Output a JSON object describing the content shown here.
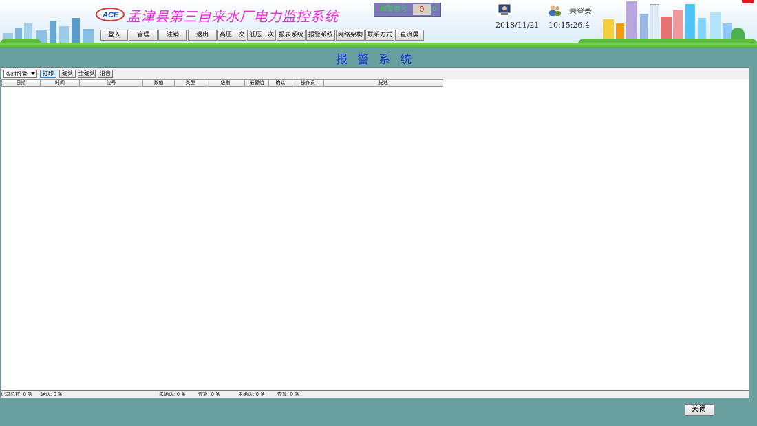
{
  "header": {
    "title": "孟津县第三自来水厂电力监控系统",
    "logo_text": "ACE",
    "status_label": "報警信号",
    "status_count": "0",
    "status_btn": "0",
    "login_status": "未登录",
    "date": "2018/11/21",
    "time": "10:15:26.4",
    "menu": [
      "登入",
      "管理",
      "注销",
      "退出",
      "高压一次",
      "低压一次",
      "报表系统",
      "报警系统",
      "网络架构",
      "联系方式",
      "直流屏"
    ]
  },
  "page_title": "报警系统",
  "toolbar": {
    "select_value": "实时报警",
    "buttons": [
      "打印",
      "确认",
      "全确认",
      "消音"
    ]
  },
  "table": {
    "columns": [
      "日期",
      "时间",
      "位号",
      "数值",
      "类型",
      "级别",
      "报警组",
      "确认",
      "操作员",
      "描述"
    ],
    "rows": []
  },
  "footer": {
    "total": "记录总数: 0 条",
    "confirmed": "确认: 0 条",
    "unconfirmed1": "未确认: 0 条",
    "recovered1": "恢复: 0 条",
    "unconfirmed2": "未确认: 0 条",
    "recovered2": "恢复: 0 条"
  },
  "close_label": "关闭",
  "colors": {
    "background": "#6a9fa0",
    "title": "#e92bd8",
    "page_title": "#1a3bd2"
  }
}
